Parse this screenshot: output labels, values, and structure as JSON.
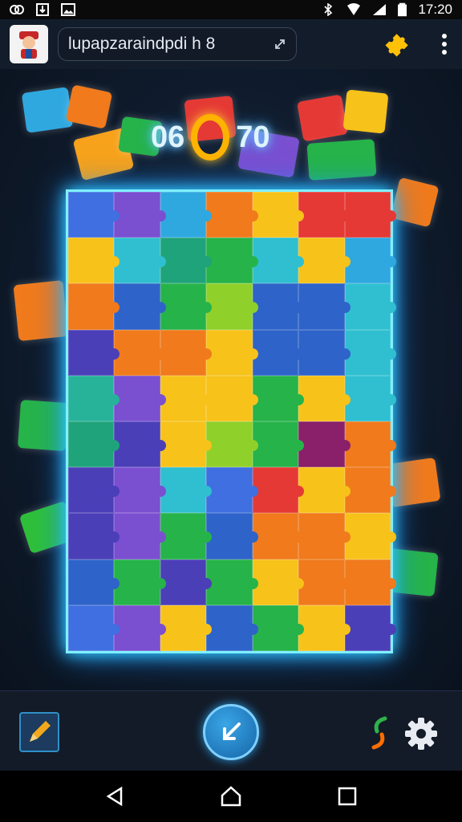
{
  "status_bar": {
    "time": "17:20"
  },
  "app_bar": {
    "title": "lupapzaraindpdi h 8"
  },
  "game": {
    "score_left": "06",
    "score_ring": "0",
    "score_right": "70",
    "tiles": [
      "#3f6fe0",
      "#7a4fd0",
      "#2fa8e0",
      "#f07a1c",
      "#f7c21a",
      "#e53935",
      "#e53935",
      "#f7c21a",
      "#2fbfd0",
      "#1fa37a",
      "#26b34a",
      "#2fbfd0",
      "#f7c21a",
      "#2fa8e0",
      "#f07a1c",
      "#2e63c9",
      "#26b34a",
      "#8fd02a",
      "#2e63c9",
      "#2e63c9",
      "#2fbfd0",
      "#4b3fb8",
      "#f07a1c",
      "#f07a1c",
      "#f7c21a",
      "#2e63c9",
      "#2e63c9",
      "#2fbfd0",
      "#26b39a",
      "#7a4fd0",
      "#f7c21a",
      "#f7c21a",
      "#26b34a",
      "#f7c21a",
      "#2fbfd0",
      "#1fa37a",
      "#4b3fb8",
      "#f7c21a",
      "#8fd02a",
      "#26b34a",
      "#8a1f6a",
      "#f07a1c",
      "#4b3fb8",
      "#7a4fd0",
      "#2fbfd0",
      "#3f6fe0",
      "#e53935",
      "#f7c21a",
      "#f07a1c",
      "#4b3fb8",
      "#7a4fd0",
      "#26b34a",
      "#2e63c9",
      "#f07a1c",
      "#f07a1c",
      "#f7c21a",
      "#2e63c9",
      "#26b34a",
      "#4b3fb8",
      "#26b34a",
      "#f7c21a",
      "#f07a1c",
      "#f07a1c",
      "#3f6fe0",
      "#7a4fd0",
      "#f7c21a",
      "#2e63c9",
      "#26b34a",
      "#f7c21a",
      "#4b3fb8"
    ]
  }
}
